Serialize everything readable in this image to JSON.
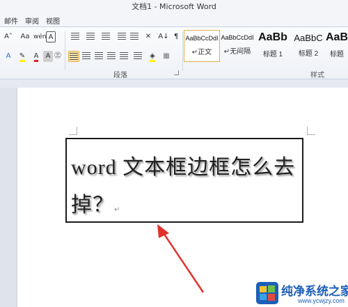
{
  "window": {
    "title": "文档1 - Microsoft Word"
  },
  "tabs": [
    "邮件",
    "审阅",
    "视图"
  ],
  "ribbon": {
    "font_group": {
      "font_size_buttons": [
        "A˄",
        "A˅"
      ],
      "change_case": "Aa",
      "phonetic": "wén",
      "char_border": "A"
    },
    "paragraph_group": {
      "label": "段落",
      "sort_label": "A↓"
    },
    "styles_group": {
      "label": "样式",
      "items": [
        {
          "sample": "AaBbCcDdI",
          "name": "↵正文",
          "selected": true
        },
        {
          "sample": "AaBbCcDdI",
          "name": "↵无间隔",
          "selected": false
        },
        {
          "sample": "AaBb",
          "name": "标题 1",
          "selected": false
        },
        {
          "sample": "AaBbC",
          "name": "标题 2",
          "selected": false
        },
        {
          "sample": "AaBb",
          "name": "标题",
          "selected": false
        }
      ]
    }
  },
  "document": {
    "textbox_text": "word 文本框边框怎么去掉？",
    "paragraph_mark": "↵"
  },
  "watermark": {
    "title": "纯净系统之家",
    "url": "www.ycwjzy.com"
  },
  "colors": {
    "arrow": "#e0322b",
    "highlight": "#fff200",
    "font_red": "#e02020",
    "accent": "#1d5fb8"
  }
}
